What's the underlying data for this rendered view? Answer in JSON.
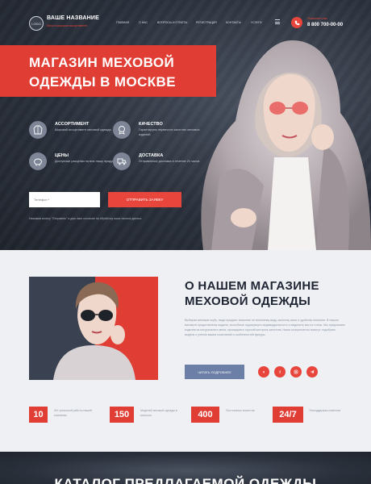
{
  "header": {
    "logo_text": "LOGO",
    "brand_name": "ВАШЕ НАЗВАНИЕ",
    "brand_sub": "Меха в широком ассортименте",
    "nav": [
      "Главная",
      "О нас",
      "Вопросы и ответы",
      "Регистрация",
      "Контакты",
      "Услуги"
    ],
    "phone_label": "Позвоните нам",
    "phone_number": "8 800 700-00-00"
  },
  "hero": {
    "title": "МАГАЗИН МЕХОВОЙ ОДЕЖДЫ В МОСКВЕ",
    "features": [
      {
        "icon": "fur-coat-icon",
        "title": "АССОРТИМЕНТ",
        "text": "Широкий ассортимент меховой одежды"
      },
      {
        "icon": "medal-icon",
        "title": "КАЧЕСТВО",
        "text": "Гарантируем первичное качество меховых изделий"
      },
      {
        "icon": "piggy-bank-icon",
        "title": "ЦЕНЫ",
        "text": "Доступные расценки на всю нашу продукцию"
      },
      {
        "icon": "delivery-icon",
        "title": "ДОСТАВКА",
        "text": "Отправление доставка в течение 24 часов"
      }
    ],
    "phone_placeholder": "Телефон *",
    "submit_label": "ОТПРАВИТЬ ЗАЯВКУ",
    "consent": "Нажимая кнопку \"Отправить\" я даю свое согласие на обработку моих личных данных"
  },
  "about": {
    "title": "О НАШЕМ МАГАЗИНЕ МЕХОВОЙ ОДЕЖДЫ",
    "text": "Выбирая меховую шубу, люди придают значение ее внешнему виду, качеству меха и удобству ношения. В нашем магазине представлены модели, способные подчеркнуть индивидуальность и выделить вас из толпы. Мы предлагаем изделия из натурального меха, прошедшего строгий контроль качества. Наши консультанты помогут подобрать модель с учетом ваших пожеланий и особенностей фигуры.",
    "more_label": "ЧИТАТЬ ПОДРОБНЕЕ",
    "socials": [
      "vk-icon",
      "facebook-icon",
      "instagram-icon",
      "telegram-icon"
    ]
  },
  "stats": [
    {
      "value": "10",
      "text": "Лет успешной работы нашей компании"
    },
    {
      "value": "150",
      "text": "Моделей меховой одежды в каталоге"
    },
    {
      "value": "400",
      "text": "Постоянных клиентов"
    },
    {
      "value": "24/7",
      "text": "Техподдержка клиентов"
    }
  ],
  "catalog": {
    "title": "КАТАЛОГ ПРЕДЛАГАЕМОЙ ОДЕЖДЫ"
  },
  "colors": {
    "accent": "#e03e35",
    "dark": "#2b313c",
    "button_blue": "#6c7fa7",
    "light_bg": "#eef0f4"
  }
}
